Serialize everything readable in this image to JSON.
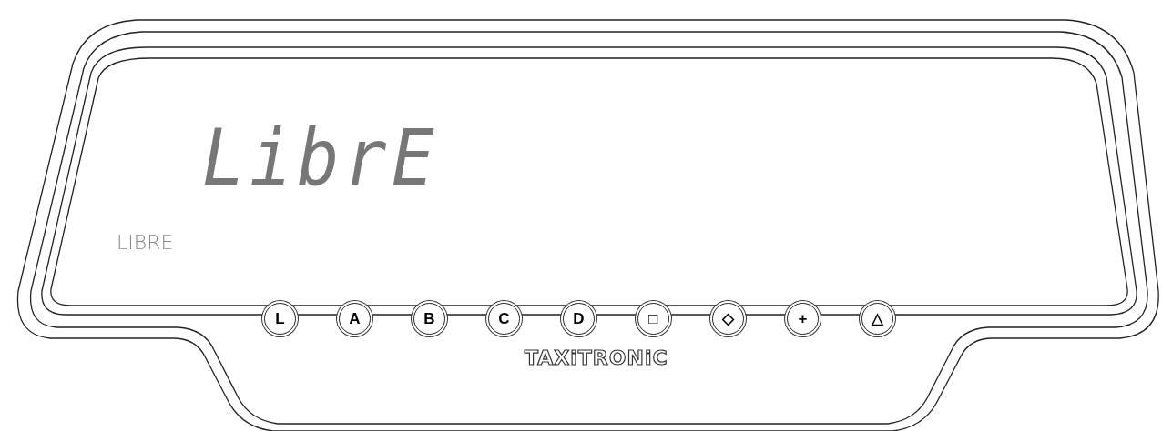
{
  "display": {
    "reading": "LibrE",
    "status_label": "LIBRE"
  },
  "buttons": [
    {
      "label": "L"
    },
    {
      "label": "A"
    },
    {
      "label": "B"
    },
    {
      "label": "C"
    },
    {
      "label": "D"
    },
    {
      "label": "□"
    },
    {
      "label": "◇"
    },
    {
      "label": "+"
    },
    {
      "label": "△"
    }
  ],
  "brand": "TAXiTRONiC"
}
